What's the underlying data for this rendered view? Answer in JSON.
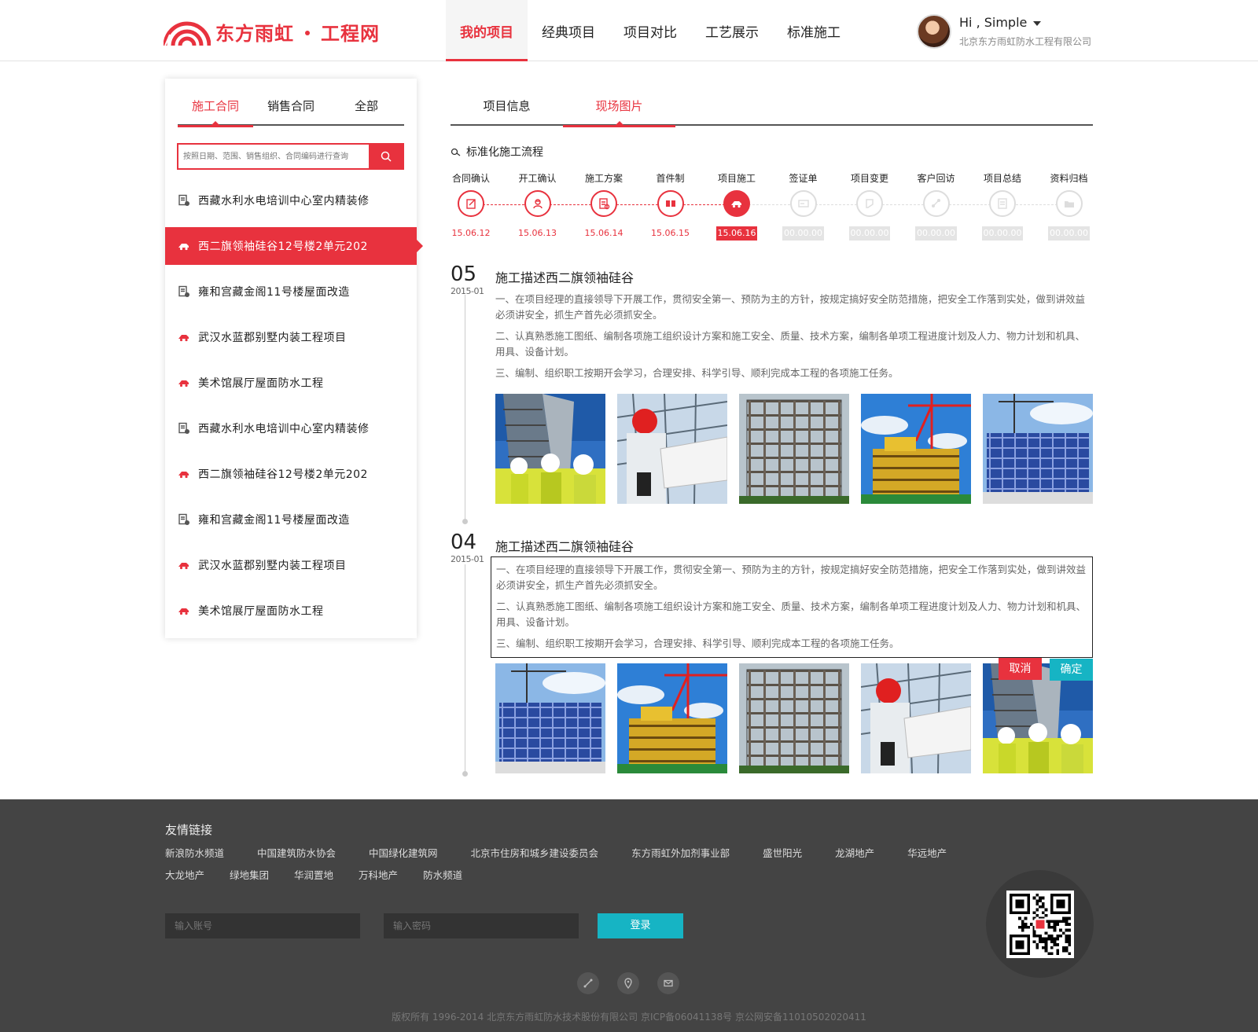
{
  "brand": {
    "name": "东方雨虹",
    "sub": "工程网",
    "color": "#e8323e"
  },
  "nav": [
    {
      "label": "我的项目",
      "active": true
    },
    {
      "label": "经典项目"
    },
    {
      "label": "项目对比"
    },
    {
      "label": "工艺展示"
    },
    {
      "label": "标准施工"
    }
  ],
  "user": {
    "greeting": "Hi , Simple",
    "company": "北京东方雨虹防水工程有限公司"
  },
  "left_tabs": [
    {
      "label": "施工合同",
      "active": true
    },
    {
      "label": "销售合同"
    },
    {
      "label": "全部"
    }
  ],
  "search": {
    "placeholder": "按照日期、范围、销售组织、合同编码进行查询"
  },
  "projects": [
    {
      "name": "西藏水利水电培训中心室内精装修",
      "icon": "doc-check-icon"
    },
    {
      "name": "西二旗领袖硅谷12号楼2单元202",
      "icon": "truck-icon",
      "active": true
    },
    {
      "name": "雍和宫藏金阁11号楼屋面改造",
      "icon": "doc-check-icon"
    },
    {
      "name": "武汉水蓝郡别墅内装工程项目",
      "icon": "truck-icon"
    },
    {
      "name": "美术馆展厅屋面防水工程",
      "icon": "truck-icon"
    },
    {
      "name": "西藏水利水电培训中心室内精装修",
      "icon": "doc-check-icon"
    },
    {
      "name": "西二旗领袖硅谷12号楼2单元202",
      "icon": "truck-icon"
    },
    {
      "name": "雍和宫藏金阁11号楼屋面改造",
      "icon": "doc-check-icon"
    },
    {
      "name": "武汉水蓝郡别墅内装工程项目",
      "icon": "truck-icon"
    },
    {
      "name": "美术馆展厅屋面防水工程",
      "icon": "truck-icon"
    }
  ],
  "right_tabs": [
    {
      "label": "项目信息"
    },
    {
      "label": "现场图片",
      "active": true
    }
  ],
  "flow": {
    "title": "标准化施工流程",
    "steps": [
      {
        "label": "合同确认",
        "date": "15.06.12",
        "state": "done",
        "icon": "edit-icon"
      },
      {
        "label": "开工确认",
        "date": "15.06.13",
        "state": "done",
        "icon": "worker-icon"
      },
      {
        "label": "施工方案",
        "date": "15.06.14",
        "state": "done",
        "icon": "plan-icon"
      },
      {
        "label": "首件制",
        "date": "15.06.15",
        "state": "done",
        "icon": "sample-icon"
      },
      {
        "label": "项目施工",
        "date": "15.06.16",
        "state": "current",
        "icon": "truck-icon"
      },
      {
        "label": "签证单",
        "date": "00.00.00",
        "state": "todo",
        "icon": "card-icon"
      },
      {
        "label": "项目变更",
        "date": "00.00.00",
        "state": "todo",
        "icon": "change-icon"
      },
      {
        "label": "客户回访",
        "date": "00.00.00",
        "state": "todo",
        "icon": "phone-icon"
      },
      {
        "label": "项目总结",
        "date": "00.00.00",
        "state": "todo",
        "icon": "summary-icon"
      },
      {
        "label": "资料归档",
        "date": "00.00.00",
        "state": "todo",
        "icon": "folder-icon"
      }
    ]
  },
  "entries": [
    {
      "day": "05",
      "month": "2015-01",
      "title": "施工描述西二旗领袖硅谷",
      "paragraphs": [
        "一、在项目经理的直接领导下开展工作，贯彻安全第一、预防为主的方针，按规定搞好安全防范措施，把安全工作落到实处，做到讲效益必须讲安全，抓生产首先必须抓安全。",
        "二、认真熟悉施工图纸、编制各项施工组织设计方案和施工安全、质量、技术方案，编制各单项工程进度计划及人力、物力计划和机具、用具、设备计划。",
        "三、编制、组织职工按期开会学习，合理安排、科学引导、顺利完成本工程的各项施工任务。"
      ],
      "photos": [
        "workers-photo",
        "engineer-photo",
        "building-photo",
        "crane-photo",
        "steel-frame-photo"
      ]
    },
    {
      "day": "04",
      "month": "2015-01",
      "title": "施工描述西二旗领袖硅谷",
      "paragraphs": [
        "一、在项目经理的直接领导下开展工作，贯彻安全第一、预防为主的方针，按规定搞好安全防范措施，把安全工作落到实处，做到讲效益必须讲安全，抓生产首先必须抓安全。",
        "二、认真熟悉施工图纸、编制各项施工组织设计方案和施工安全、质量、技术方案，编制各单项工程进度计划及人力、物力计划和机具、用具、设备计划。",
        "三、编制、组织职工按期开会学习，合理安排、科学引导、顺利完成本工程的各项施工任务。"
      ],
      "photos": [
        "steel-frame-photo",
        "crane-photo",
        "building-photo",
        "engineer-photo",
        "workers-photo"
      ],
      "cancel_label": "取消",
      "confirm_label": "确定"
    }
  ],
  "footer": {
    "links_title": "友情链接",
    "links_row1": [
      "新浪防水频道",
      "中国建筑防水协会",
      "中国绿化建筑网",
      "北京市住房和城乡建设委员会",
      "东方雨虹外加剂事业部",
      "盛世阳光",
      "龙湖地产",
      "华远地产"
    ],
    "links_row2": [
      "大龙地产",
      "绿地集团",
      "华润置地",
      "万科地产",
      "防水频道"
    ],
    "account_placeholder": "输入账号",
    "password_placeholder": "输入密码",
    "login_label": "登录",
    "copyright": "版权所有 1996-2014 北京东方雨虹防水技术股份有限公司    京ICP备06041138号    京公网安备11010502020411"
  }
}
